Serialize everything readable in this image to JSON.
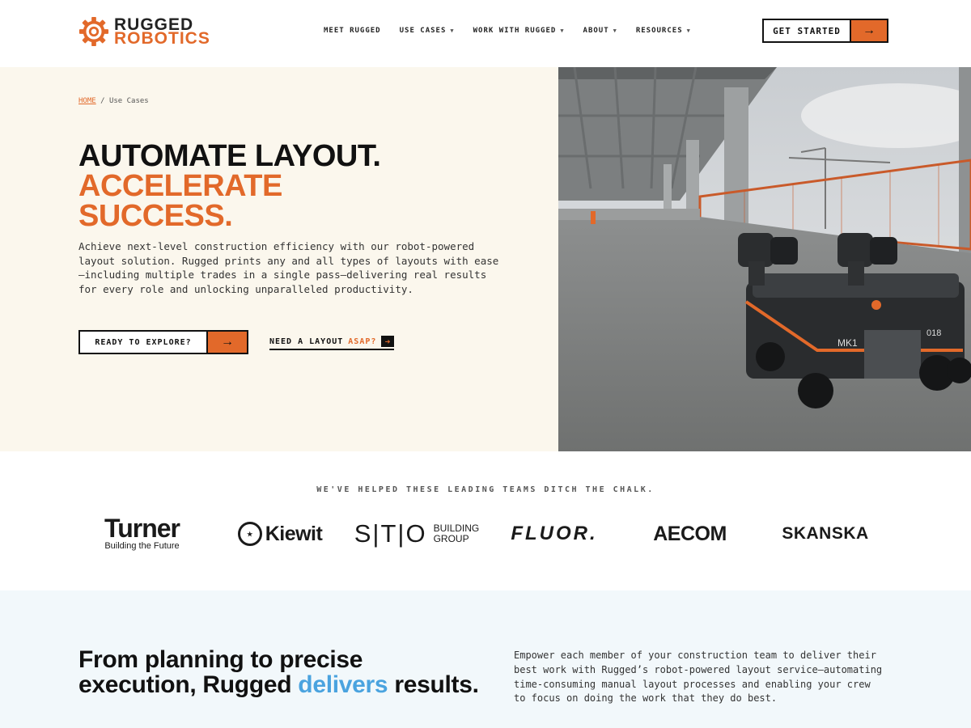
{
  "brand": {
    "line1": "RUGGED",
    "line2": "ROBOTICS",
    "accent_color": "#e2692a"
  },
  "nav": {
    "items": [
      {
        "label": "MEET RUGGED",
        "has_dropdown": false
      },
      {
        "label": "USE CASES",
        "has_dropdown": true
      },
      {
        "label": "WORK WITH RUGGED",
        "has_dropdown": true
      },
      {
        "label": "ABOUT",
        "has_dropdown": true
      },
      {
        "label": "RESOURCES",
        "has_dropdown": true
      }
    ],
    "cta_label": "GET STARTED"
  },
  "breadcrumb": {
    "home": "HOME",
    "separator": "/",
    "current": "Use Cases"
  },
  "hero": {
    "headline_line1": "AUTOMATE LAYOUT.",
    "headline_line2": "ACCELERATE",
    "headline_line3": "SUCCESS.",
    "description": "Achieve next-level construction efficiency with our robot-powered layout solution. Rugged prints any and all types of layouts with ease—including multiple trades in a single pass—delivering real results for every role and unlocking unparalleled productivity.",
    "primary_cta": "READY TO EXPLORE?",
    "secondary_cta": "NEED A LAYOUT",
    "secondary_cta_highlight": "ASAP?",
    "robot_label_left": "MK1",
    "robot_label_right": "018"
  },
  "partners": {
    "title": "WE'VE HELPED THESE LEADING TEAMS DITCH THE CHALK.",
    "turner_name": "Turner",
    "turner_tagline": "Building the Future",
    "kiewit": "Kiewit",
    "sto_mark": "S|T|O",
    "sto_line1": "BUILDING",
    "sto_line2": "GROUP",
    "fluor": "FLUOR.",
    "aecom": "AECOM",
    "skanska": "SKANSKA"
  },
  "bottom": {
    "heading_part1": "From planning to precise execution, Rugged ",
    "heading_highlight": "delivers",
    "heading_part2": " results.",
    "description": "Empower each member of your construction team to deliver their best work with Rugged’s robot-powered layout service—automating time-consuming manual layout processes and enabling your crew to focus on doing the work that they do best."
  }
}
